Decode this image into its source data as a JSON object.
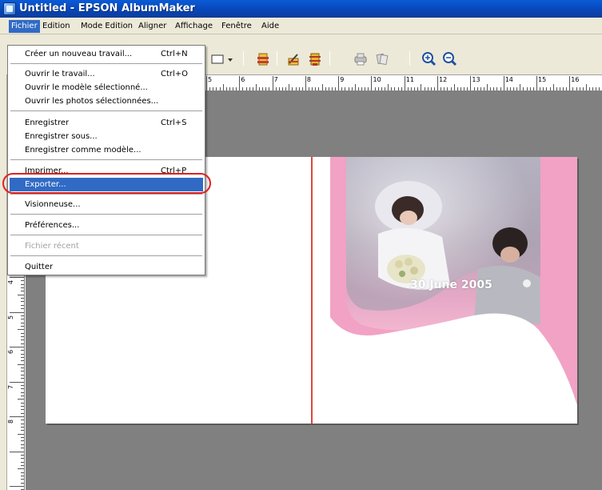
{
  "window": {
    "title": "Untitled - EPSON AlbumMaker"
  },
  "menubar": {
    "items": [
      "Fichier",
      "Edition",
      "Mode Edition",
      "Aligner",
      "Affichage",
      "Fenêtre",
      "Aide"
    ],
    "active": "Fichier"
  },
  "file_menu": {
    "items": [
      {
        "label": "Créer un nouveau travail...",
        "shortcut": "Ctrl+N"
      },
      {
        "label": "Ouvrir le travail...",
        "shortcut": "Ctrl+O"
      },
      {
        "label": "Ouvrir le modèle sélectionné...",
        "shortcut": ""
      },
      {
        "label": "Ouvrir les photos sélectionnées...",
        "shortcut": ""
      },
      {
        "label": "Enregistrer",
        "shortcut": "Ctrl+S"
      },
      {
        "label": "Enregistrer sous...",
        "shortcut": ""
      },
      {
        "label": "Enregistrer comme modèle...",
        "shortcut": ""
      },
      {
        "label": "Imprimer...",
        "shortcut": "Ctrl+P"
      },
      {
        "label": "Exporter...",
        "shortcut": ""
      },
      {
        "label": "Visionneuse...",
        "shortcut": ""
      },
      {
        "label": "Préférences...",
        "shortcut": ""
      },
      {
        "label": "Fichier récent",
        "shortcut": ""
      },
      {
        "label": "Quitter",
        "shortcut": ""
      }
    ],
    "selected": "Exporter...",
    "disabled": [
      "Fichier récent"
    ]
  },
  "ruler": {
    "h_numbers": [
      "5",
      "6",
      "7",
      "8",
      "9",
      "10",
      "11",
      "12",
      "13",
      "14",
      "15",
      "16"
    ],
    "v_numbers": [
      "4",
      "5",
      "6",
      "7",
      "8"
    ]
  },
  "canvas": {
    "date_text": "30 June 2005"
  },
  "colors": {
    "titlebar": "#0846b8",
    "menu_highlight": "#316ac5",
    "divider": "#e2473a",
    "pink": "#f2a2c4",
    "annotation_ring": "#e02020"
  }
}
